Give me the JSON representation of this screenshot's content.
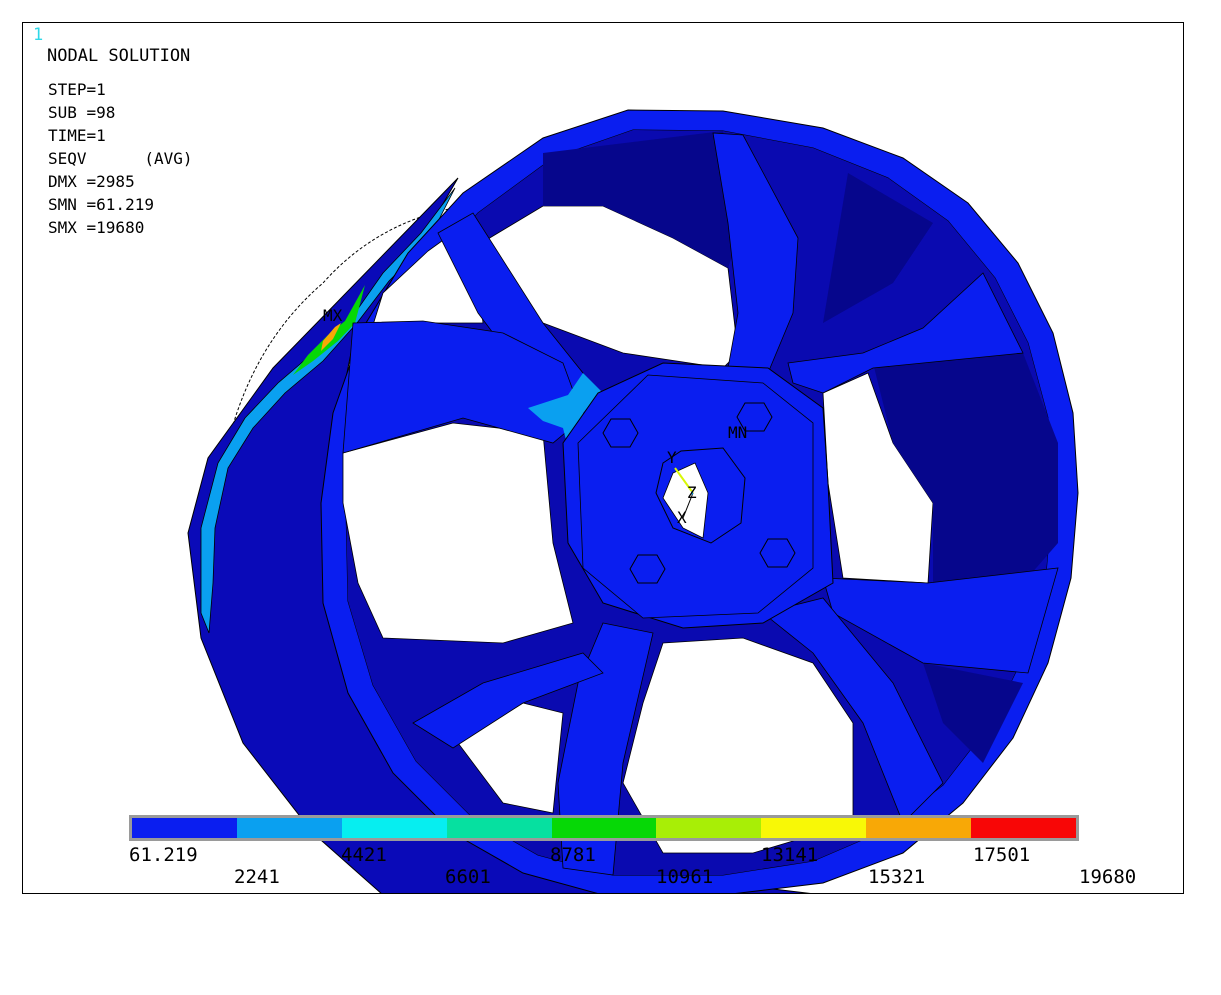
{
  "window_number": "1",
  "title": "NODAL SOLUTION",
  "info_lines": {
    "step": "STEP=1",
    "sub": "SUB =98",
    "time": "TIME=1",
    "seqv": "SEQV      (AVG)",
    "dmx": "DMX =2985",
    "smn": "SMN =61.219",
    "smx": "SMX =19680"
  },
  "markers": {
    "mx": "MX",
    "mn": "MN"
  },
  "axes": {
    "y": "Y",
    "z": "Z",
    "x": "X"
  },
  "legend": {
    "colors": [
      "#0a1ef0",
      "#0aa0f0",
      "#06eef0",
      "#06e0a0",
      "#06d806",
      "#a8ee06",
      "#f8f806",
      "#f8a806",
      "#f80606"
    ],
    "labels_top": [
      "61.219",
      "4421",
      "8781",
      "13141",
      "17501"
    ],
    "labels_bottom": [
      "2241",
      "6601",
      "10961",
      "15321",
      "19680"
    ]
  }
}
